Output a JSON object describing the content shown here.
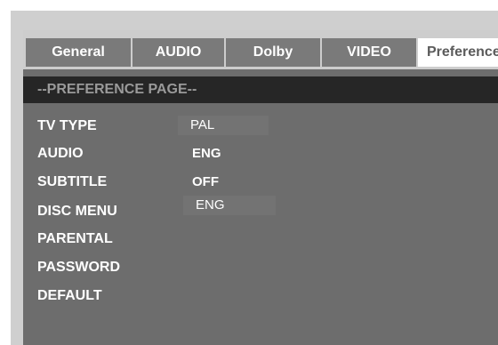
{
  "tabs": [
    {
      "label": "General",
      "active": false
    },
    {
      "label": "AUDIO",
      "active": false
    },
    {
      "label": "Dolby",
      "active": false
    },
    {
      "label": "VIDEO",
      "active": false
    },
    {
      "label": "Preference",
      "active": true
    }
  ],
  "page_title": "--PREFERENCE PAGE--",
  "settings": [
    {
      "label": "TV TYPE",
      "value": "PAL"
    },
    {
      "label": "AUDIO",
      "value": "ENG"
    },
    {
      "label": "SUBTITLE",
      "value": "OFF"
    },
    {
      "label": "DISC MENU",
      "value": "ENG"
    },
    {
      "label": "PARENTAL",
      "value": ""
    },
    {
      "label": "PASSWORD",
      "value": ""
    },
    {
      "label": "DEFAULT",
      "value": ""
    }
  ],
  "colors": {
    "panel_bg": "#6d6d6d",
    "tab_bg": "#7a7a7a",
    "active_tab_bg": "#ffffff",
    "header_bg": "#262626",
    "header_text": "#9a9a9a"
  }
}
